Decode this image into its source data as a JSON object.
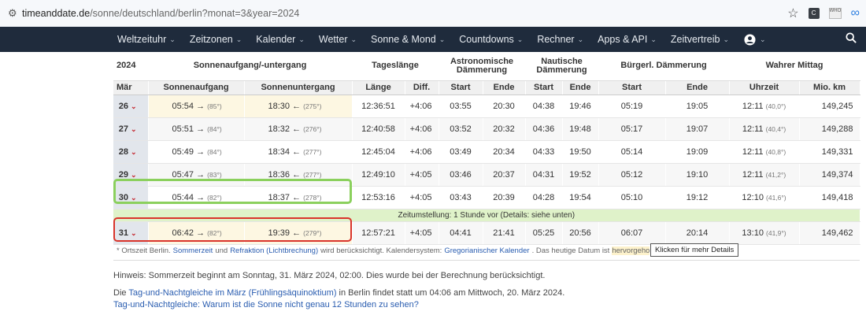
{
  "browser": {
    "url_host": "timeanddate.de",
    "url_path": "/sonne/deutschland/berlin?monat=3&year=2024",
    "ext1": "C",
    "ext2": "WHO"
  },
  "nav": {
    "items": [
      {
        "label": "Weltzeituhr"
      },
      {
        "label": "Zeitzonen"
      },
      {
        "label": "Kalender"
      },
      {
        "label": "Wetter"
      },
      {
        "label": "Sonne & Mond"
      },
      {
        "label": "Countdowns"
      },
      {
        "label": "Rechner"
      },
      {
        "label": "Apps & API"
      },
      {
        "label": "Zeitvertreib"
      }
    ]
  },
  "table": {
    "year": "2024",
    "group_sun": "Sonnenaufgang/-untergang",
    "group_day": "Tageslänge",
    "group_astro": "Astronomische Dämmerung",
    "group_naut": "Nautische Dämmerung",
    "group_civil": "Bürgerl. Dämmerung",
    "group_noon": "Wahrer Mittag",
    "month": "Mär",
    "col_sunrise": "Sonnenaufgang",
    "col_sunset": "Sonnenuntergang",
    "col_length": "Länge",
    "col_diff": "Diff.",
    "col_start": "Start",
    "col_end": "Ende",
    "col_time": "Uhrzeit",
    "col_dist": "Mio. km",
    "rows": [
      {
        "day": "26",
        "sr": "05:54",
        "sr_deg": "(85°)",
        "ss": "18:30",
        "ss_deg": "(275°)",
        "len": "12:36:51",
        "diff": "+4:06",
        "as": "03:55",
        "ae": "20:30",
        "ns": "04:38",
        "ne": "19:46",
        "cs": "05:19",
        "ce": "19:05",
        "noon": "12:11",
        "noon_deg": "(40,0°)",
        "dist": "149,245"
      },
      {
        "day": "27",
        "sr": "05:51",
        "sr_deg": "(84°)",
        "ss": "18:32",
        "ss_deg": "(276°)",
        "len": "12:40:58",
        "diff": "+4:06",
        "as": "03:52",
        "ae": "20:32",
        "ns": "04:36",
        "ne": "19:48",
        "cs": "05:17",
        "ce": "19:07",
        "noon": "12:11",
        "noon_deg": "(40,4°)",
        "dist": "149,288"
      },
      {
        "day": "28",
        "sr": "05:49",
        "sr_deg": "(84°)",
        "ss": "18:34",
        "ss_deg": "(277°)",
        "len": "12:45:04",
        "diff": "+4:06",
        "as": "03:49",
        "ae": "20:34",
        "ns": "04:33",
        "ne": "19:50",
        "cs": "05:14",
        "ce": "19:09",
        "noon": "12:11",
        "noon_deg": "(40,8°)",
        "dist": "149,331"
      },
      {
        "day": "29",
        "sr": "05:47",
        "sr_deg": "(83°)",
        "ss": "18:36",
        "ss_deg": "(277°)",
        "len": "12:49:10",
        "diff": "+4:05",
        "as": "03:46",
        "ae": "20:37",
        "ns": "04:31",
        "ne": "19:52",
        "cs": "05:12",
        "ce": "19:10",
        "noon": "12:11",
        "noon_deg": "(41,2°)",
        "dist": "149,374"
      },
      {
        "day": "30",
        "sr": "05:44",
        "sr_deg": "(82°)",
        "ss": "18:37",
        "ss_deg": "(278°)",
        "len": "12:53:16",
        "diff": "+4:05",
        "as": "03:43",
        "ae": "20:39",
        "ns": "04:28",
        "ne": "19:54",
        "cs": "05:10",
        "ce": "19:12",
        "noon": "12:10",
        "noon_deg": "(41,6°)",
        "dist": "149,418"
      }
    ],
    "note": "Zeitumstellung: 1 Stunde vor (Details: siehe unten)",
    "last_row": {
      "day": "31",
      "sr": "06:42",
      "sr_deg": "(82°)",
      "ss": "19:39",
      "ss_deg": "(279°)",
      "len": "12:57:21",
      "diff": "+4:05",
      "as": "04:41",
      "ae": "21:41",
      "ns": "05:25",
      "ne": "20:56",
      "cs": "06:07",
      "ce": "20:14",
      "noon": "13:10",
      "noon_deg": "(41,9°)",
      "dist": "149,462"
    }
  },
  "footnote": {
    "t1": "* Ortszeit Berlin.",
    "l1": "Sommerzeit",
    "t2": "und",
    "l2": "Refraktion (Lichtbrechung)",
    "t3": "wird berücksichtigt. Kalendersystem:",
    "l3": "Gregorianischer Kalender",
    "t4": ". Das heutige Datum ist",
    "hv": "hervorgeho",
    "tooltip": "Klicken für mehr Details"
  },
  "info": {
    "p1": "Hinweis: Sommerzeit beginnt am Sonntag, 31. März 2024, 02:00. Dies wurde bei der Berechnung berücksichtigt.",
    "p2_pre": "Die",
    "p2_link": "Tag-und-Nachtgleiche im März (Frühlingsäquinoktium)",
    "p2_post": "in Berlin findet statt um 04:06 am Mittwoch, 20. März 2024.",
    "p3": "Tag-und-Nachtgleiche: Warum ist die Sonne nicht genau 12 Stunden zu sehen?"
  }
}
